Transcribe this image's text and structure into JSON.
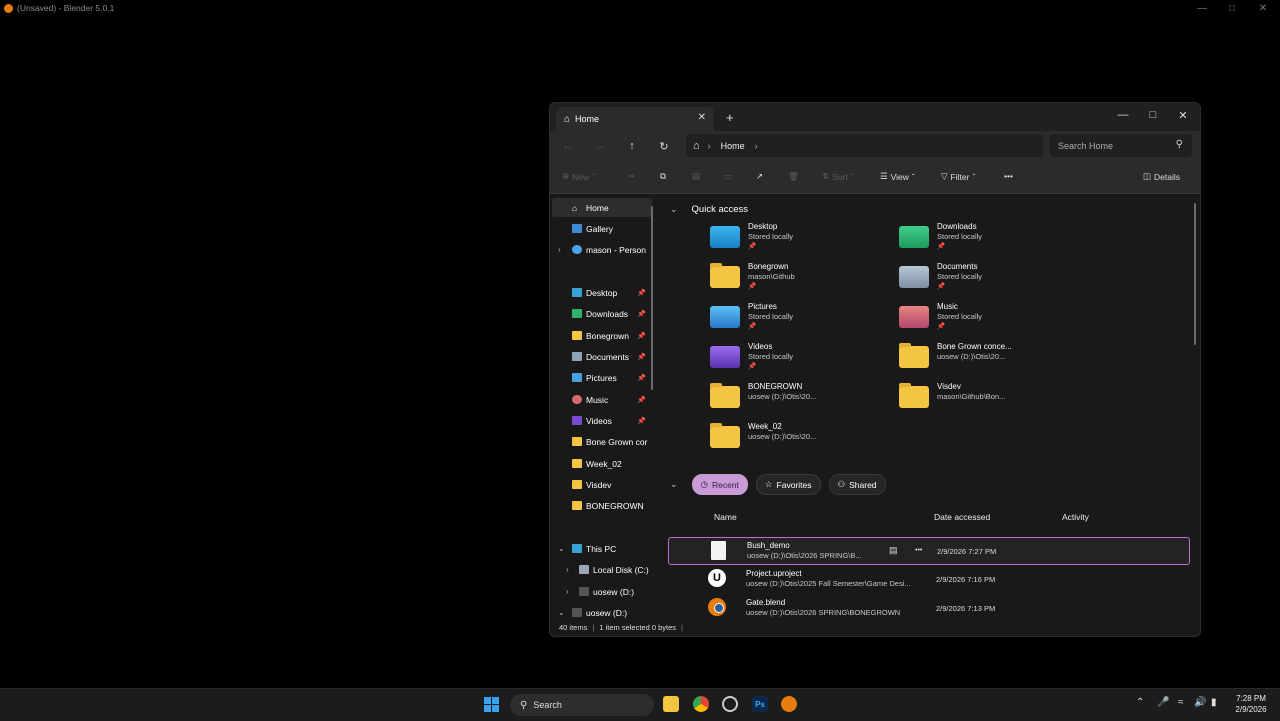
{
  "background_window": {
    "title": "(Unsaved) - Blender 5.0.1"
  },
  "explorer": {
    "tab": {
      "label": "Home"
    },
    "address": {
      "crumb": "Home"
    },
    "search": {
      "placeholder": "Search Home"
    },
    "commands": {
      "new": "New",
      "sort": "Sort",
      "view": "View",
      "filter": "Filter",
      "details": "Details"
    },
    "sidebar": {
      "top": [
        "Home",
        "Gallery",
        "mason - Person"
      ],
      "pinned": [
        "Desktop",
        "Downloads",
        "Bonegrown",
        "Documents",
        "Pictures",
        "Music",
        "Videos"
      ],
      "folders": [
        "Bone Grown cor",
        "Week_02",
        "Visdev",
        "BONEGROWN"
      ],
      "this_pc": "This PC",
      "drives": [
        "Local Disk (C:)",
        "uosew (D:)",
        "uosew (D:)"
      ]
    },
    "quick_access": {
      "title": "Quick access",
      "items": [
        {
          "name": "Desktop",
          "sub": "Stored locally",
          "pinned": true,
          "icon": "desktop-folder-icon"
        },
        {
          "name": "Downloads",
          "sub": "Stored locally",
          "pinned": true,
          "icon": "downloads-folder-icon"
        },
        {
          "name": "Bonegrown",
          "sub": "mason\\Github",
          "pinned": true,
          "icon": "folder-icon"
        },
        {
          "name": "Documents",
          "sub": "Stored locally",
          "pinned": true,
          "icon": "documents-folder-icon"
        },
        {
          "name": "Pictures",
          "sub": "Stored locally",
          "pinned": true,
          "icon": "pictures-folder-icon"
        },
        {
          "name": "Music",
          "sub": "Stored locally",
          "pinned": true,
          "icon": "music-folder-icon"
        },
        {
          "name": "Videos",
          "sub": "Stored locally",
          "pinned": true,
          "icon": "videos-folder-icon"
        },
        {
          "name": "Bone Grown conce...",
          "sub": "uosew (D:)\\Otis\\20...",
          "pinned": false,
          "icon": "folder-icon"
        },
        {
          "name": "BONEGROWN",
          "sub": "uosew (D:)\\Otis\\20...",
          "pinned": false,
          "icon": "folder-icon"
        },
        {
          "name": "Visdev",
          "sub": "mason\\Github\\Bon...",
          "pinned": false,
          "icon": "folder-icon"
        },
        {
          "name": "Week_02",
          "sub": "uosew (D:)\\Otis\\20...",
          "pinned": false,
          "icon": "folder-icon"
        }
      ]
    },
    "filters": {
      "recent": "Recent",
      "favorites": "Favorites",
      "shared": "Shared"
    },
    "columns": {
      "name": "Name",
      "date": "Date accessed",
      "activity": "Activity"
    },
    "recent_files": [
      {
        "name": "Bush_demo",
        "path": "uosew (D:)\\Otis\\2026 SPRING\\B...",
        "date": "2/9/2026 7:27 PM",
        "selected": true,
        "icon": "blank-file-icon"
      },
      {
        "name": "Project.uproject",
        "path": "uosew (D:)\\Otis\\2025 Fall Semester\\Game Desi...",
        "date": "2/9/2026 7:16 PM",
        "selected": false,
        "icon": "unreal-icon"
      },
      {
        "name": "Gate.blend",
        "path": "uosew (D:)\\Otis\\2026 SPRING\\BONEGROWN",
        "date": "2/9/2026 7:13 PM",
        "selected": false,
        "icon": "blender-icon"
      }
    ],
    "status": {
      "count": "40 items",
      "selection": "1 item selected  0 bytes"
    }
  },
  "taskbar": {
    "search": "Search",
    "time": "7:28 PM",
    "date": "2/9/2026"
  },
  "colors": {
    "accent": "#c89ad6",
    "folder": "#f4c542",
    "background": "#000000"
  }
}
